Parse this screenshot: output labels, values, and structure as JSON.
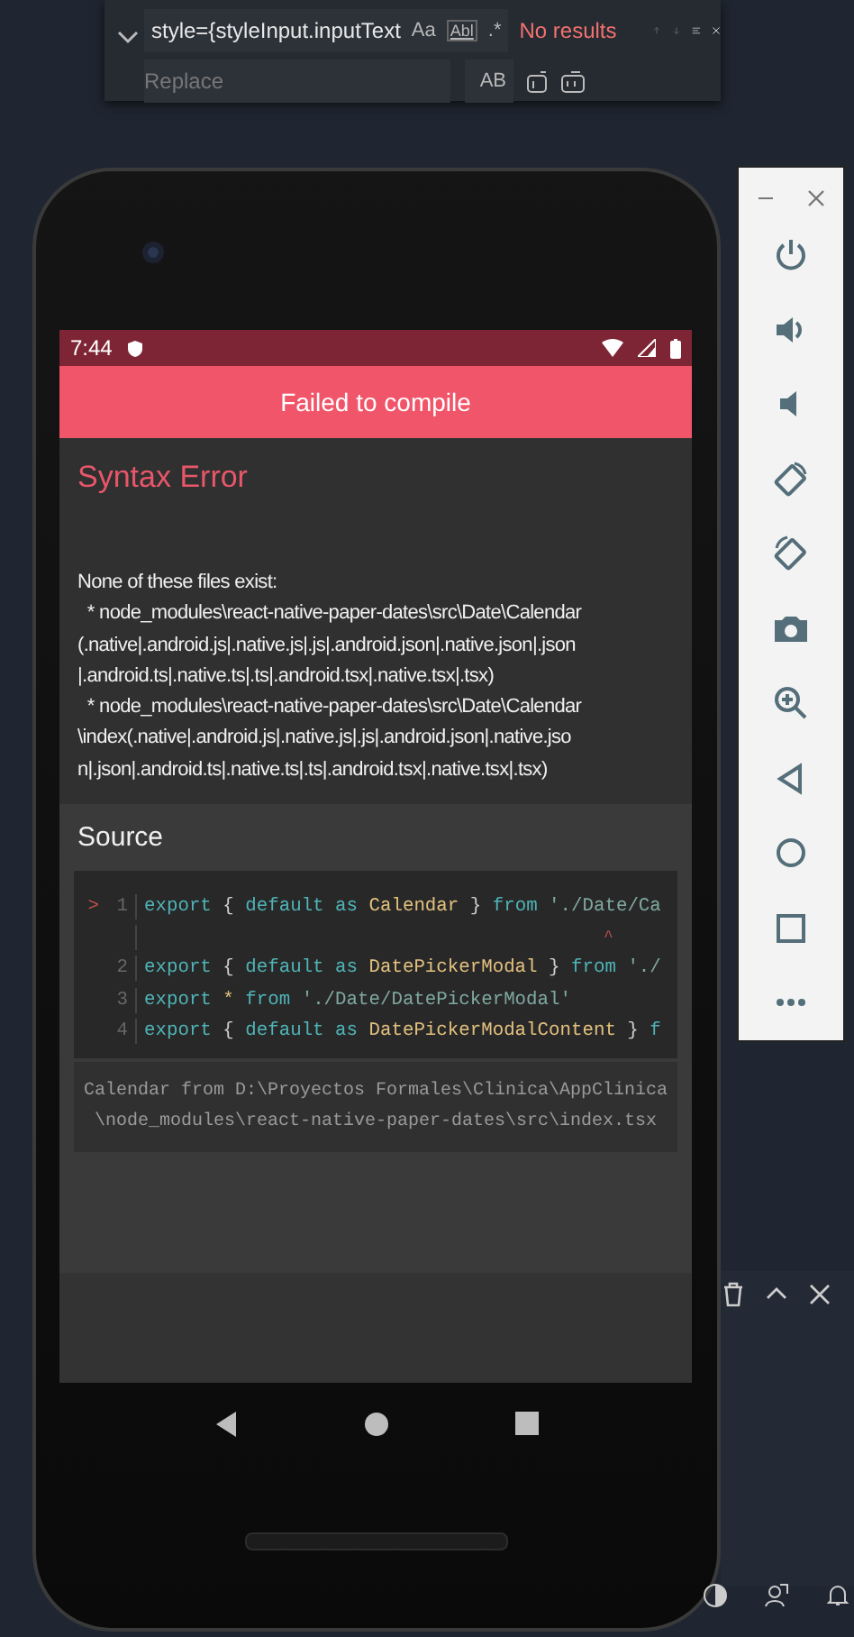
{
  "find_widget": {
    "find_value": "style={styleInput.inputText",
    "options": [
      {
        "text": "Aa",
        "kind": "case"
      },
      {
        "text": "Abl",
        "kind": "word"
      },
      {
        "text": ".*",
        "kind": "regex"
      }
    ],
    "status": "No results",
    "replace": {
      "placeholder": "Replace",
      "option": "AB"
    }
  },
  "phone": {
    "status_bar": {
      "time": "7:44"
    },
    "header": {
      "title": "Failed to compile"
    },
    "error": {
      "title": "Syntax Error",
      "message_lines": [
        "None of these files exist:",
        "  * node_modules\\react-native-paper-dates\\src\\Date\\Calendar",
        "(.native|.android.js|.native.js|.js|.android.json|.native.json|.json",
        "|.android.ts|.native.ts|.ts|.android.tsx|.native.tsx|.tsx)",
        "  * node_modules\\react-native-paper-dates\\src\\Date\\Calendar",
        "\\index(.native|.android.js|.native.js|.js|.android.json|.native.jso",
        "n|.json|.android.ts|.native.ts|.ts|.android.tsx|.native.tsx|.tsx)"
      ]
    },
    "source": {
      "title": "Source",
      "code_lines": [
        {
          "kind": "code",
          "marker": ">",
          "number": "1",
          "tokens": [
            {
              "text": "export",
              "kind": "keyword"
            },
            {
              "text": " { ",
              "kind": "punct"
            },
            {
              "text": "default",
              "kind": "keyword"
            },
            {
              "text": " as ",
              "kind": "keyword"
            },
            {
              "text": "Calendar",
              "kind": "ident"
            },
            {
              "text": " } ",
              "kind": "punct"
            },
            {
              "text": "from",
              "kind": "keyword"
            },
            {
              "text": " './Date/Ca",
              "kind": "string"
            }
          ]
        },
        {
          "kind": "caret",
          "text": "^"
        },
        {
          "kind": "code",
          "number": "2",
          "tokens": [
            {
              "text": "export",
              "kind": "keyword"
            },
            {
              "text": " { ",
              "kind": "punct"
            },
            {
              "text": "default",
              "kind": "keyword"
            },
            {
              "text": " as ",
              "kind": "keyword"
            },
            {
              "text": "DatePickerModal",
              "kind": "ident"
            },
            {
              "text": " } ",
              "kind": "punct"
            },
            {
              "text": "from",
              "kind": "keyword"
            },
            {
              "text": " './",
              "kind": "string"
            }
          ]
        },
        {
          "kind": "code",
          "number": "3",
          "tokens": [
            {
              "text": "export",
              "kind": "keyword"
            },
            {
              "text": " * ",
              "kind": "op"
            },
            {
              "text": "from",
              "kind": "keyword"
            },
            {
              "text": " './Date/DatePickerModal'",
              "kind": "string"
            }
          ]
        },
        {
          "kind": "code",
          "number": "4",
          "tokens": [
            {
              "text": "export",
              "kind": "keyword"
            },
            {
              "text": " { ",
              "kind": "punct"
            },
            {
              "text": "default",
              "kind": "keyword"
            },
            {
              "text": " as ",
              "kind": "keyword"
            },
            {
              "text": "DatePickerModalContent",
              "kind": "ident"
            },
            {
              "text": " } ",
              "kind": "punct"
            },
            {
              "text": "f",
              "kind": "keyword"
            }
          ]
        }
      ],
      "location_lines": [
        "Calendar from D:\\Proyectos Formales\\Clinica\\AppClinica",
        "\\node_modules\\react-native-paper-dates\\src\\index.tsx"
      ]
    }
  }
}
